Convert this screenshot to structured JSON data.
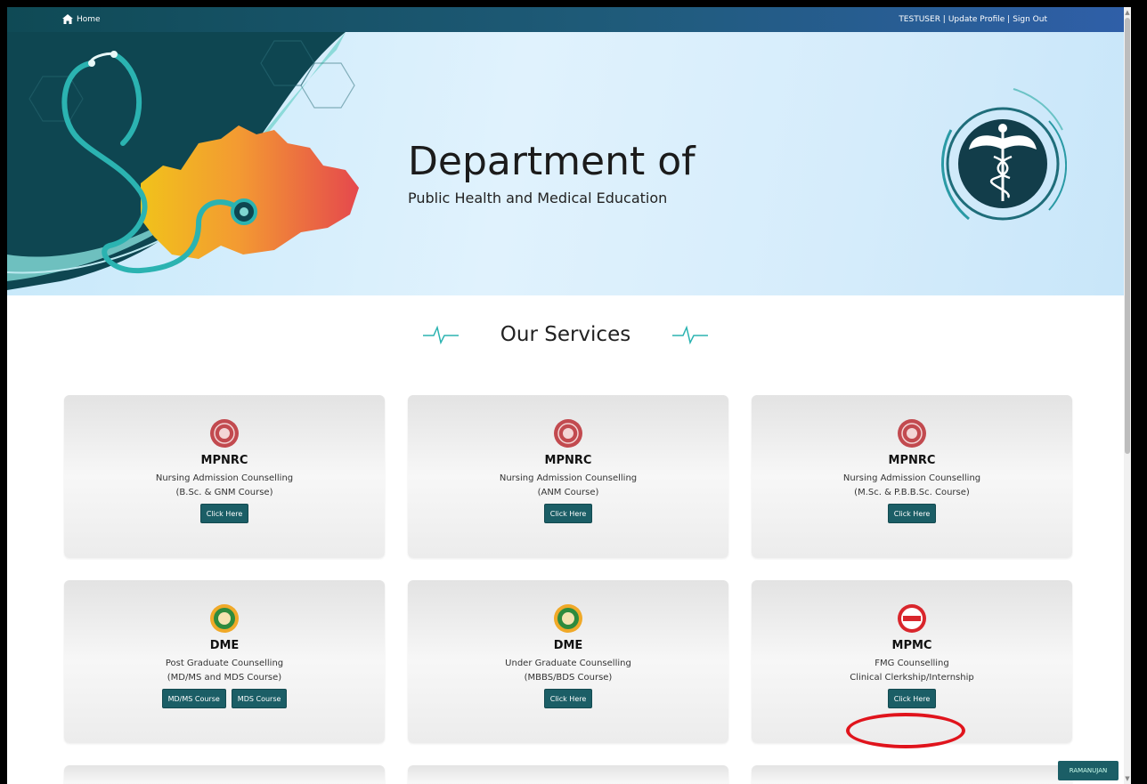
{
  "topbar": {
    "home_label": "Home",
    "user_label": "TESTUSER |",
    "update_profile_label": "Update Profile |",
    "sign_out_label": "Sign Out"
  },
  "banner": {
    "title": "Department of",
    "subtitle": "Public Health and Medical Education"
  },
  "services": {
    "heading": "Our Services",
    "cards": [
      {
        "org": "MPNRC",
        "line1": "Nursing Admission Counselling",
        "line2": "(B.Sc. & GNM Course)",
        "buttons": [
          "Click Here"
        ]
      },
      {
        "org": "MPNRC",
        "line1": "Nursing Admission Counselling",
        "line2": "(ANM Course)",
        "buttons": [
          "Click Here"
        ]
      },
      {
        "org": "MPNRC",
        "line1": "Nursing Admission Counselling",
        "line2": "(M.Sc. & P.B.B.Sc. Course)",
        "buttons": [
          "Click Here"
        ]
      },
      {
        "org": "DME",
        "line1": "Post Graduate Counselling",
        "line2": "(MD/MS and MDS Course)",
        "buttons": [
          "MD/MS Course",
          "MDS Course"
        ]
      },
      {
        "org": "DME",
        "line1": "Under Graduate Counselling",
        "line2": "(MBBS/BDS Course)",
        "buttons": [
          "Click Here"
        ]
      },
      {
        "org": "MPMC",
        "line1": "FMG Counselling",
        "line2": "Clinical Clerkship/Internship",
        "buttons": [
          "Click Here"
        ]
      }
    ]
  },
  "corner_tag": "RAMANUJAN",
  "colors": {
    "accent": "#1b5e66",
    "highlight": "#e0141c"
  }
}
